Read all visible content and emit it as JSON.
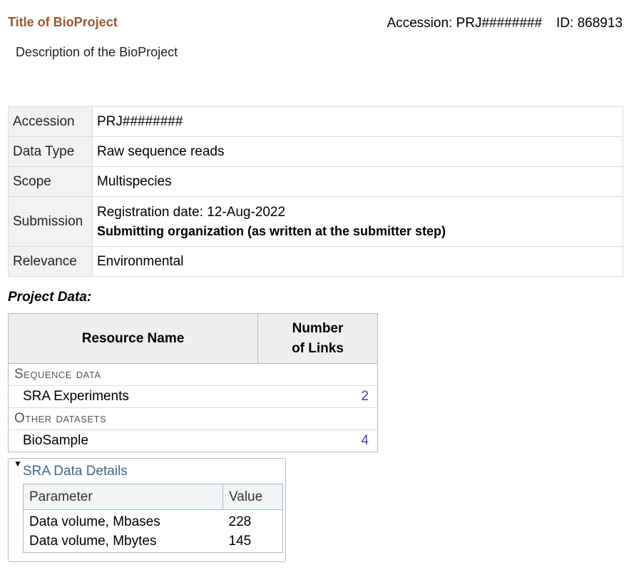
{
  "header": {
    "title": "Title of BioProject",
    "accession_text": "Accession: PRJ########",
    "id_text": "ID: 868913",
    "description": "Description of the BioProject"
  },
  "summary": {
    "rows": [
      {
        "label": "Accession",
        "value": "PRJ########"
      },
      {
        "label": "Data Type",
        "value": "Raw sequence reads"
      },
      {
        "label": "Scope",
        "value": "Multispecies"
      },
      {
        "label": "Submission",
        "value": "Registration date: 12-Aug-2022",
        "value2": "Submitting organization (as written at the submitter step)"
      },
      {
        "label": "Relevance",
        "value": "Environmental"
      }
    ]
  },
  "project_data": {
    "heading": "Project Data:",
    "col_resource": "Resource Name",
    "col_links_line1": "Number",
    "col_links_line2": "of Links",
    "categories": [
      {
        "name": "Sequence data",
        "items": [
          {
            "name": "SRA Experiments",
            "count": "2"
          }
        ]
      },
      {
        "name": "Other datasets",
        "items": [
          {
            "name": "BioSample",
            "count": "4"
          }
        ]
      }
    ]
  },
  "sra_details": {
    "toggle_icon": "triangle-down",
    "title": "SRA Data Details",
    "col_param": "Parameter",
    "col_value": "Value",
    "rows": [
      {
        "param": "Data volume, Mbases",
        "value": "228"
      },
      {
        "param": "Data volume, Mbytes",
        "value": "145"
      }
    ]
  },
  "colors": {
    "title": "#985735",
    "link": "#5b3b8c",
    "sra_title": "#3d6a8e"
  }
}
